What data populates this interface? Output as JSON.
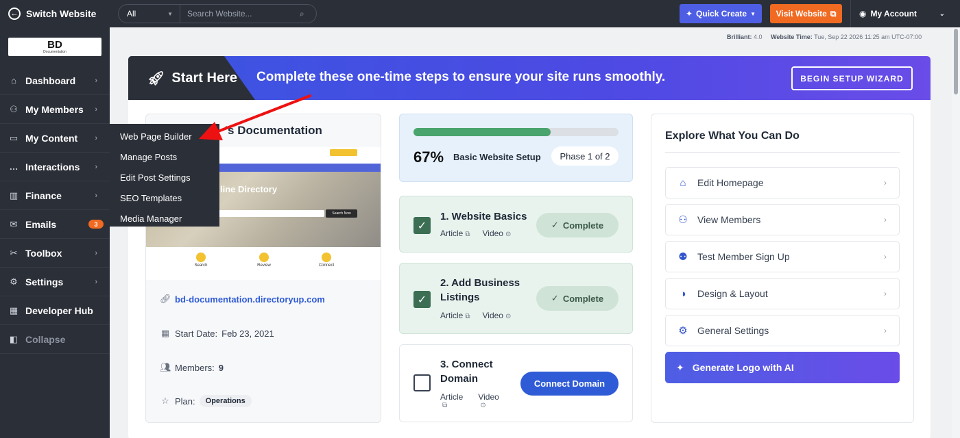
{
  "topbar": {
    "switch_label": "Switch Website",
    "search_scope": "All",
    "search_placeholder": "Search Website...",
    "quick_create": "Quick Create",
    "visit_website": "Visit Website",
    "my_account": "My Account"
  },
  "logo": {
    "big": "BD",
    "small": "Documentation"
  },
  "sidebar": {
    "items": [
      {
        "label": "Dashboard",
        "icon": "home-icon"
      },
      {
        "label": "My Members",
        "icon": "users-icon"
      },
      {
        "label": "My Content",
        "icon": "folder-icon"
      },
      {
        "label": "Interactions",
        "icon": "chat-icon"
      },
      {
        "label": "Finance",
        "icon": "chart-icon"
      },
      {
        "label": "Emails",
        "icon": "mail-icon",
        "badge": "3"
      },
      {
        "label": "Toolbox",
        "icon": "tools-icon"
      },
      {
        "label": "Settings",
        "icon": "gear-icon"
      },
      {
        "label": "Developer Hub",
        "icon": "grid-icon"
      },
      {
        "label": "Collapse",
        "icon": "collapse-icon"
      }
    ]
  },
  "flyout": [
    "Web Page Builder",
    "Manage Posts",
    "Edit Post Settings",
    "SEO Templates",
    "Media Manager"
  ],
  "meta": {
    "brilliant_label": "Brilliant:",
    "brilliant_value": "4.0",
    "time_label": "Website Time:",
    "time_value": "Tue, Sep 22 2026 11:25 am UTC-07:00"
  },
  "banner": {
    "start": "Start Here",
    "message": "Complete these one-time steps to ensure your site runs smoothly.",
    "wizard": "BEGIN SETUP WIZARD"
  },
  "site": {
    "title": "'s Documentation",
    "url": "bd-documentation.directoryup.com",
    "start_label": "Start Date:",
    "start_value": "Feb 23, 2021",
    "members_label": "Members:",
    "members_value": "9",
    "plan_label": "Plan:",
    "plan_value": "Operations",
    "thumb": {
      "hero": "line Directory",
      "f1": "Search",
      "f2": "Review",
      "f3": "Connect",
      "search_btn": "Search Now"
    }
  },
  "progress": {
    "percent_text": "67%",
    "fraction": 0.67,
    "label": "Basic Website Setup",
    "phase": "Phase 1 of 2"
  },
  "steps": [
    {
      "title": "1. Website Basics",
      "article": "Article",
      "video": "Video",
      "status": "Complete"
    },
    {
      "title": "2. Add Business Listings",
      "article": "Article",
      "video": "Video",
      "status": "Complete"
    },
    {
      "title": "3. Connect Domain",
      "article": "Article",
      "video": "Video",
      "action": "Connect Domain"
    }
  ],
  "explore": {
    "heading": "Explore What You Can Do",
    "items": [
      {
        "label": "Edit Homepage",
        "icon": "house-icon"
      },
      {
        "label": "View Members",
        "icon": "users-icon"
      },
      {
        "label": "Test Member Sign Up",
        "icon": "user-check-icon"
      },
      {
        "label": "Design & Layout",
        "icon": "palette-icon"
      },
      {
        "label": "General Settings",
        "icon": "gear-icon"
      }
    ],
    "generate": "Generate Logo with AI"
  },
  "colors": {
    "accent": "#4e5ee4",
    "orange": "#f06a22",
    "sidebar": "#2b2f38",
    "success": "#3c6e54",
    "annotation": "#ee1111"
  }
}
